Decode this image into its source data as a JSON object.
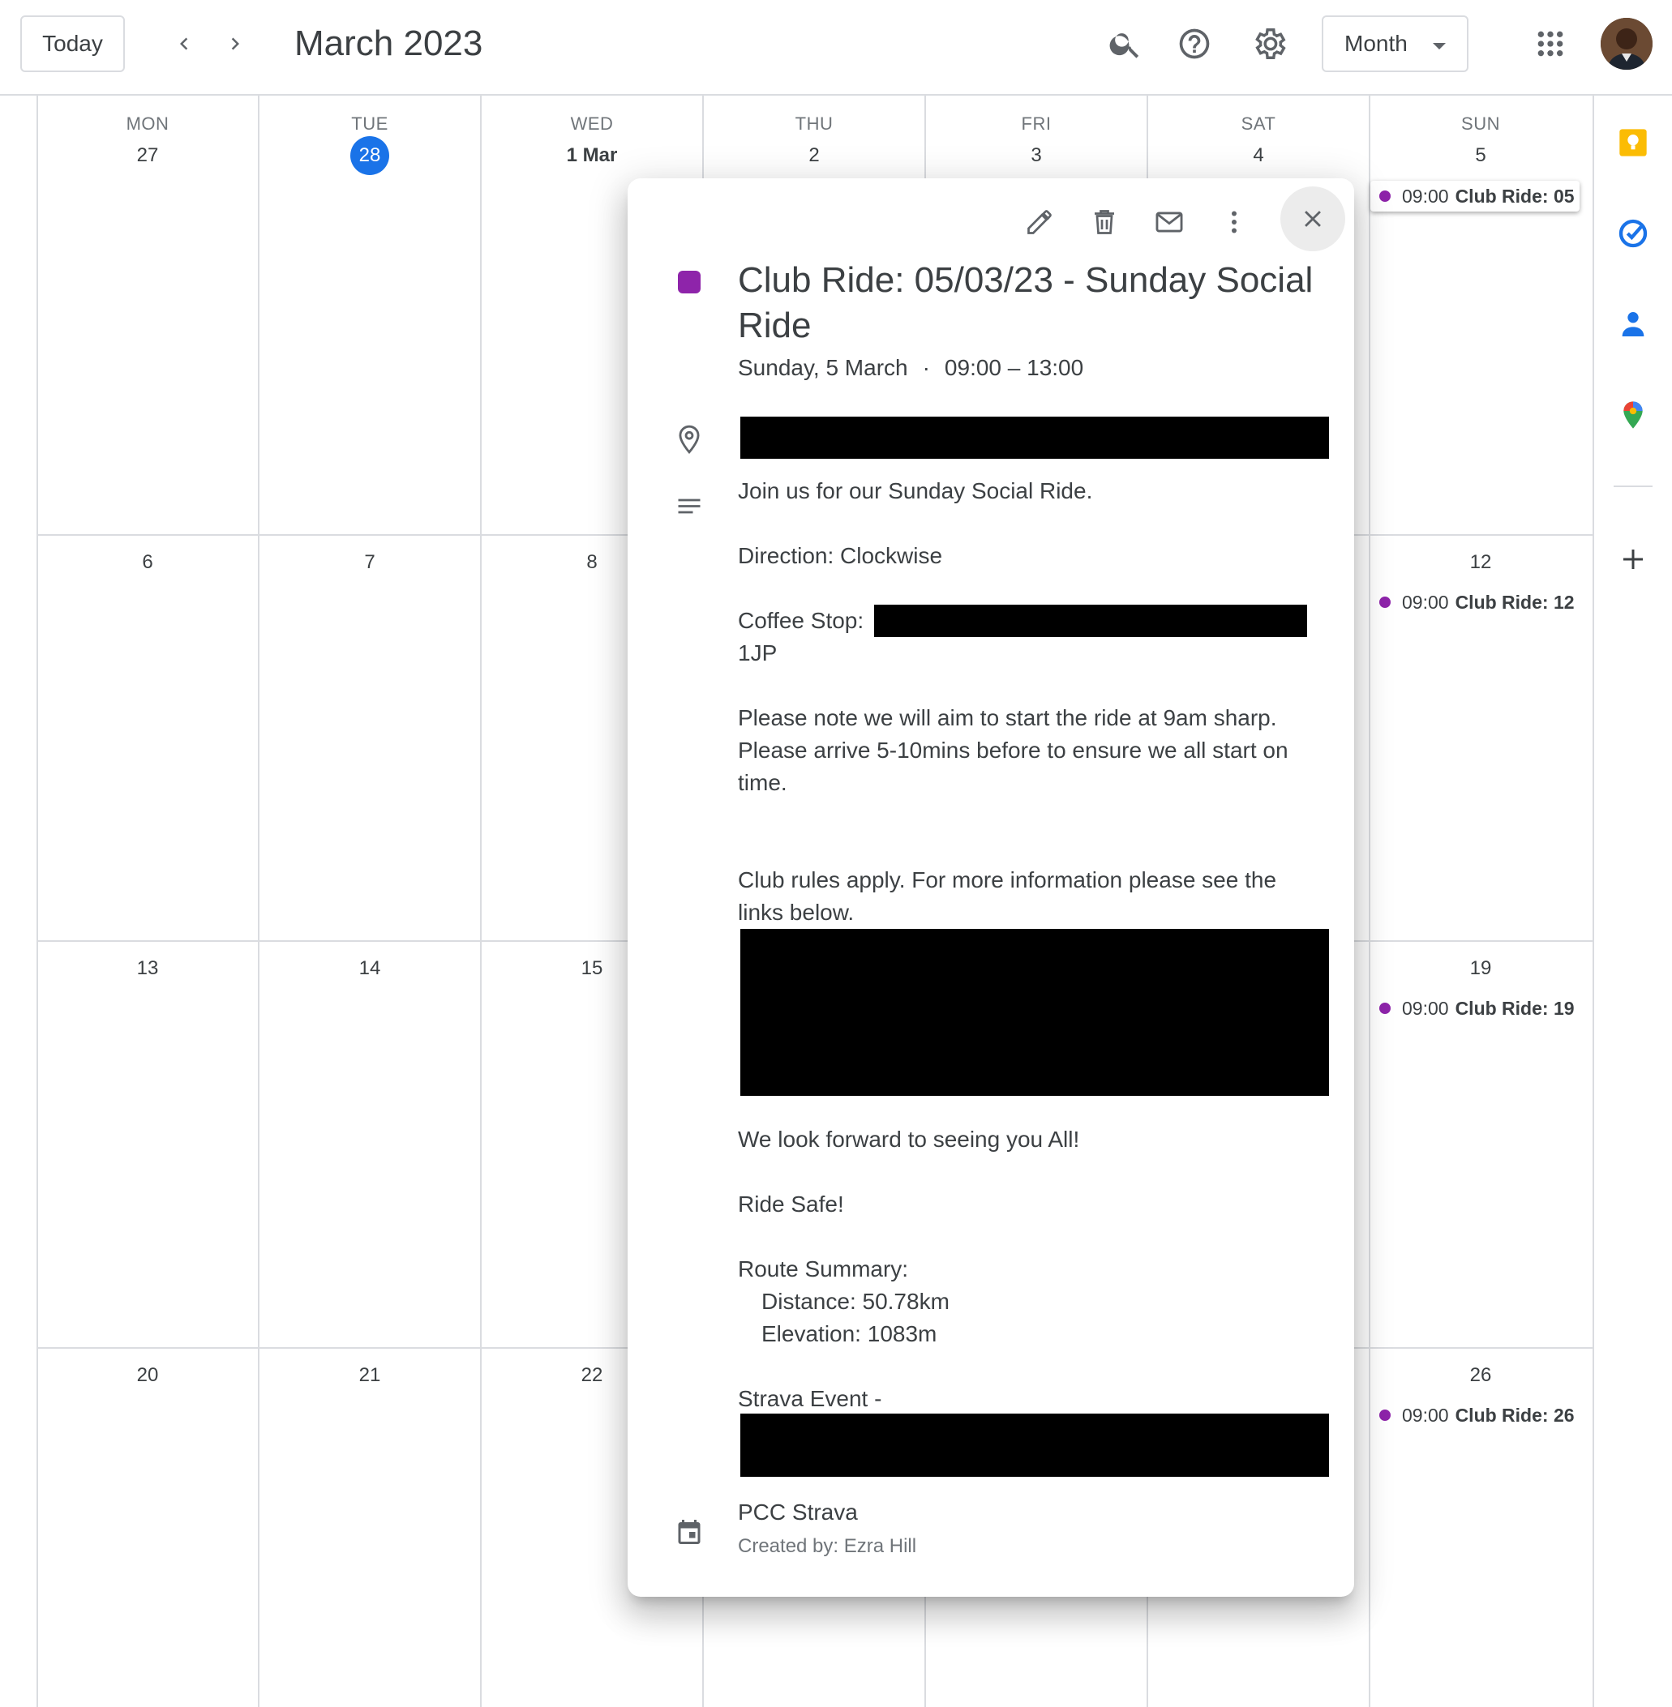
{
  "header": {
    "today_label": "Today",
    "title": "March 2023",
    "view_label": "Month"
  },
  "calendar": {
    "weekdays": [
      "MON",
      "TUE",
      "WED",
      "THU",
      "FRI",
      "SAT",
      "SUN"
    ],
    "weeks": [
      [
        "27",
        "28",
        "1 Mar",
        "2",
        "3",
        "4",
        "5"
      ],
      [
        "6",
        "7",
        "8",
        "",
        "",
        "",
        "12"
      ],
      [
        "13",
        "14",
        "15",
        "",
        "",
        "",
        "19"
      ],
      [
        "20",
        "21",
        "22",
        "",
        "",
        "",
        "26"
      ]
    ],
    "today": "28",
    "events": [
      {
        "time": "09:00",
        "title": "Club Ride: 05"
      },
      {
        "time": "09:00",
        "title": "Club Ride: 12"
      },
      {
        "time": "09:00",
        "title": "Club Ride: 19"
      },
      {
        "time": "09:00",
        "title": "Club Ride: 26"
      }
    ]
  },
  "popup": {
    "title": "Club Ride: 05/03/23 - Sunday Social Ride",
    "date": "Sunday, 5 March",
    "separator": "·",
    "time": "09:00 – 13:00",
    "description": {
      "line1": "Join us for our Sunday Social Ride.",
      "direction": "Direction:  Clockwise",
      "coffee_label": "Coffee Stop:",
      "coffee_cont": "1JP",
      "note1": "Please note we will aim to start the ride at 9am sharp.",
      "note2": "Please arrive 5-10mins before to ensure we all start on",
      "note3": "time.",
      "rules1": "Club rules apply. For more information please see the",
      "rules2": "links below.",
      "forward": "We look forward to seeing you All!",
      "safe": "Ride Safe!",
      "route_label": "Route Summary:",
      "distance": "Distance: 50.78km",
      "elevation": "Elevation: 1083m",
      "strava_label": "Strava Event -"
    },
    "calendar_name": "PCC Strava",
    "created_by": "Created by: Ezra Hill"
  },
  "colors": {
    "event": "#8e24aa",
    "today": "#1a73e8",
    "gridline": "#dadce0"
  }
}
